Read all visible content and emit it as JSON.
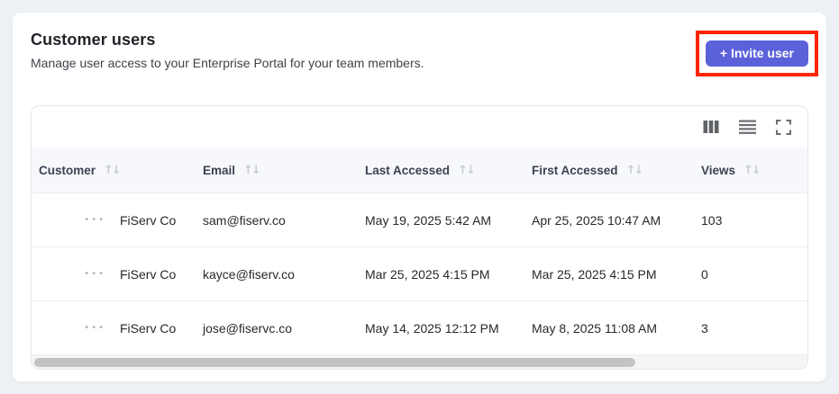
{
  "header": {
    "title": "Customer users",
    "subtitle": "Manage user access to your Enterprise Portal for your team members.",
    "invite_button_label": "+ Invite user"
  },
  "toolbar": {
    "icons": [
      "columns-icon",
      "density-icon",
      "fullscreen-icon"
    ]
  },
  "table": {
    "columns": [
      "Customer",
      "Email",
      "Last Accessed",
      "First Accessed",
      "Views"
    ],
    "sort_icon": "↑↓",
    "row_menu_icon": "•••",
    "rows": [
      {
        "customer": "FiServ Co",
        "email": "sam@fiserv.co",
        "last_accessed": "May 19, 2025 5:42 AM",
        "first_accessed": "Apr 25, 2025 10:47 AM",
        "views": "103"
      },
      {
        "customer": "FiServ Co",
        "email": "kayce@fiserv.co",
        "last_accessed": "Mar 25, 2025 4:15 PM",
        "first_accessed": "Mar 25, 2025 4:15 PM",
        "views": "0"
      },
      {
        "customer": "FiServ Co",
        "email": "jose@fiservc.co",
        "last_accessed": "May 14, 2025 12:12 PM",
        "first_accessed": "May 8, 2025 11:08 AM",
        "views": "3"
      }
    ]
  },
  "colors": {
    "accent": "#5b61d9",
    "annotation_red": "#fb2500",
    "page_bg": "#edf1f4",
    "table_header_bg": "#f7f8fb",
    "icon_gray": "#66696e"
  }
}
